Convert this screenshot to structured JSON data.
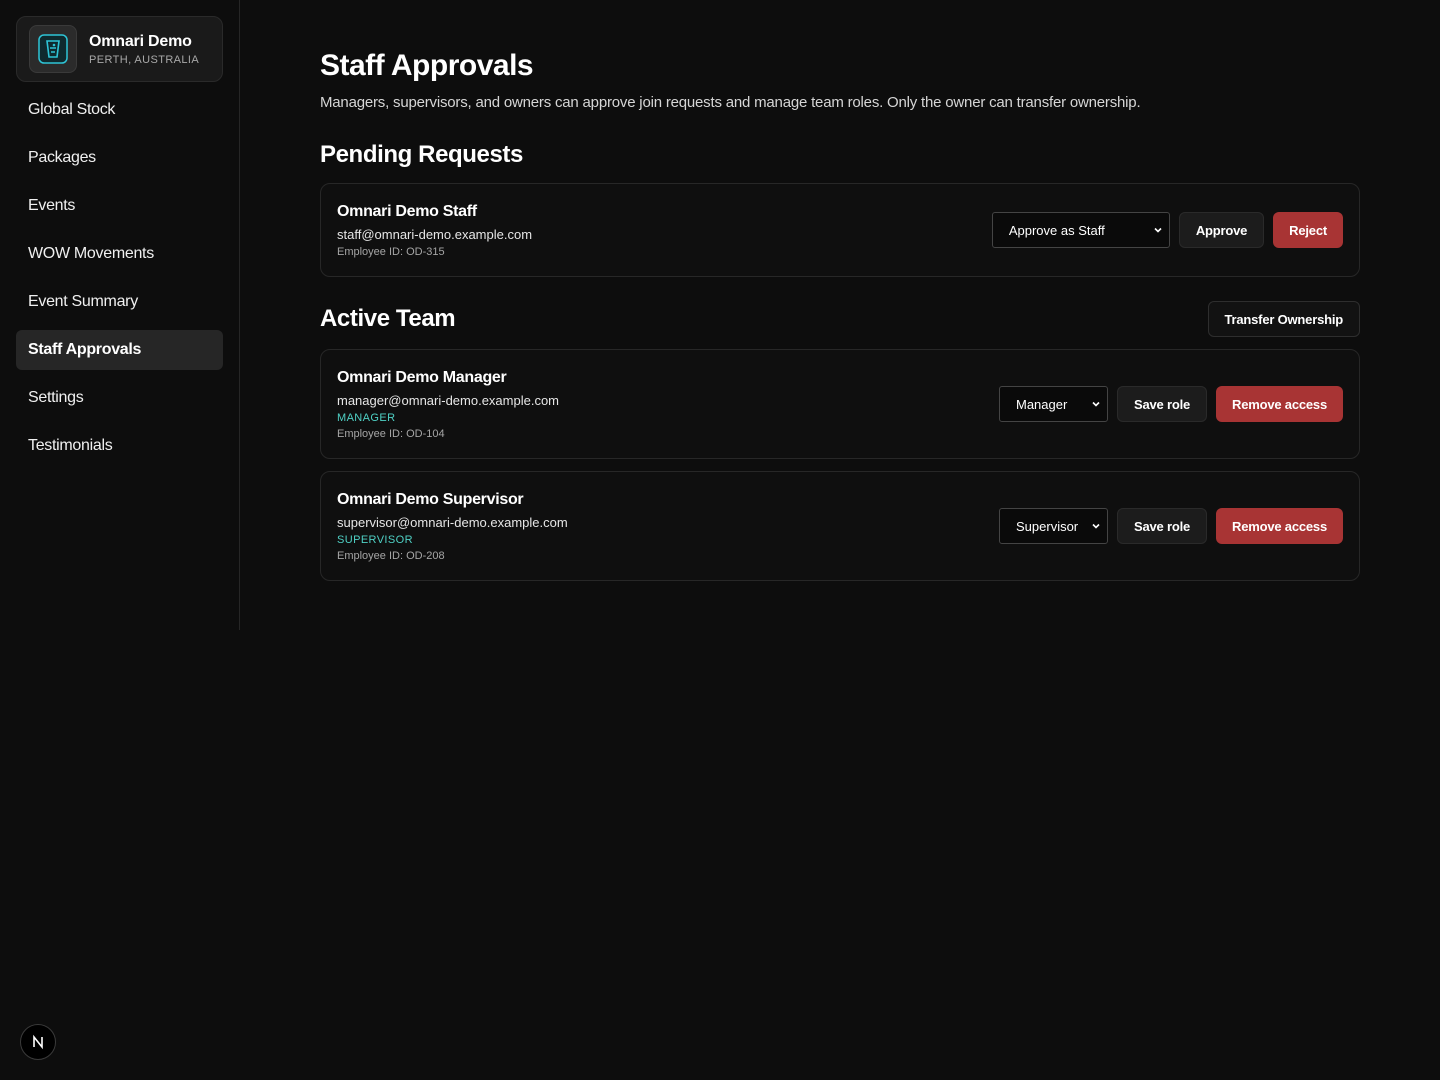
{
  "brand": {
    "name": "Omnari Demo",
    "location": "PERTH, AUSTRALIA",
    "logo_icon": "cocktail-glass-icon"
  },
  "nav": [
    {
      "label": "Global Stock",
      "active": false
    },
    {
      "label": "Packages",
      "active": false
    },
    {
      "label": "Events",
      "active": false
    },
    {
      "label": "WOW Movements",
      "active": false
    },
    {
      "label": "Event Summary",
      "active": false
    },
    {
      "label": "Staff Approvals",
      "active": true
    },
    {
      "label": "Settings",
      "active": false
    },
    {
      "label": "Testimonials",
      "active": false
    }
  ],
  "page": {
    "title": "Staff Approvals",
    "subtitle": "Managers, supervisors, and owners can approve join requests and manage team roles. Only the owner can transfer ownership."
  },
  "pending": {
    "title": "Pending Requests",
    "requests": [
      {
        "name": "Omnari Demo Staff",
        "email": "staff@omnari-demo.example.com",
        "employee_id": "Employee ID: OD-315",
        "select_value": "Approve as Staff",
        "approve_label": "Approve",
        "reject_label": "Reject"
      }
    ]
  },
  "team": {
    "title": "Active Team",
    "transfer_label": "Transfer Ownership",
    "members": [
      {
        "name": "Omnari Demo Manager",
        "email": "manager@omnari-demo.example.com",
        "role": "MANAGER",
        "employee_id": "Employee ID: OD-104",
        "select_value": "Manager",
        "save_label": "Save role",
        "remove_label": "Remove access"
      },
      {
        "name": "Omnari Demo Supervisor",
        "email": "supervisor@omnari-demo.example.com",
        "role": "SUPERVISOR",
        "employee_id": "Employee ID: OD-208",
        "select_value": "Supervisor",
        "save_label": "Save role",
        "remove_label": "Remove access"
      }
    ]
  },
  "colors": {
    "background": "#0d0d0d",
    "danger": "#a83434",
    "role_accent": "#4fd1c5",
    "logo_accent": "#2ec4d6"
  },
  "footer": {
    "badge_icon": "nextjs-n-icon"
  }
}
